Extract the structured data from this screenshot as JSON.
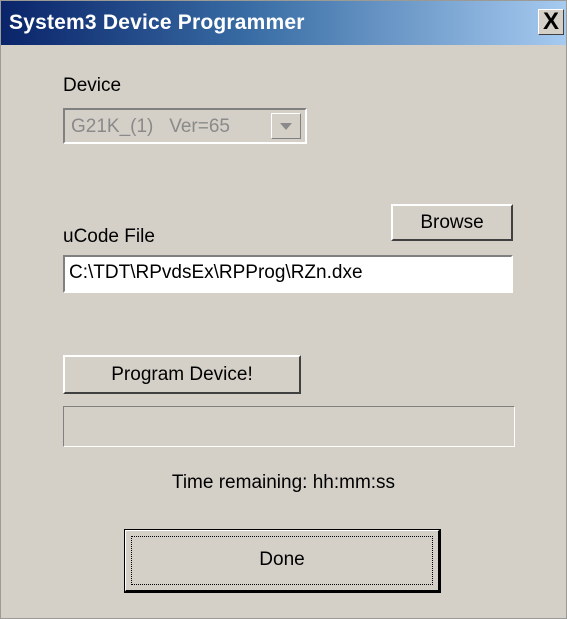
{
  "window": {
    "title": "System3 Device Programmer",
    "close_symbol": "✕"
  },
  "device": {
    "label": "Device",
    "selected_value": "G21K_(1)   Ver=65",
    "enabled": false
  },
  "ucode": {
    "label": "uCode File",
    "browse_label": "Browse",
    "file_path": "C:\\TDT\\RPvdsEx\\RPProg\\RZn.dxe"
  },
  "program": {
    "button_label": "Program Device!",
    "progress_fraction": 0,
    "time_remaining": "Time remaining: hh:mm:ss"
  },
  "footer": {
    "done_label": "Done"
  },
  "colors": {
    "dialog_bg": "#d4d0c8",
    "titlebar_start": "#0a246a",
    "titlebar_end": "#a6caf0",
    "disabled_text": "#8a8a8a"
  }
}
